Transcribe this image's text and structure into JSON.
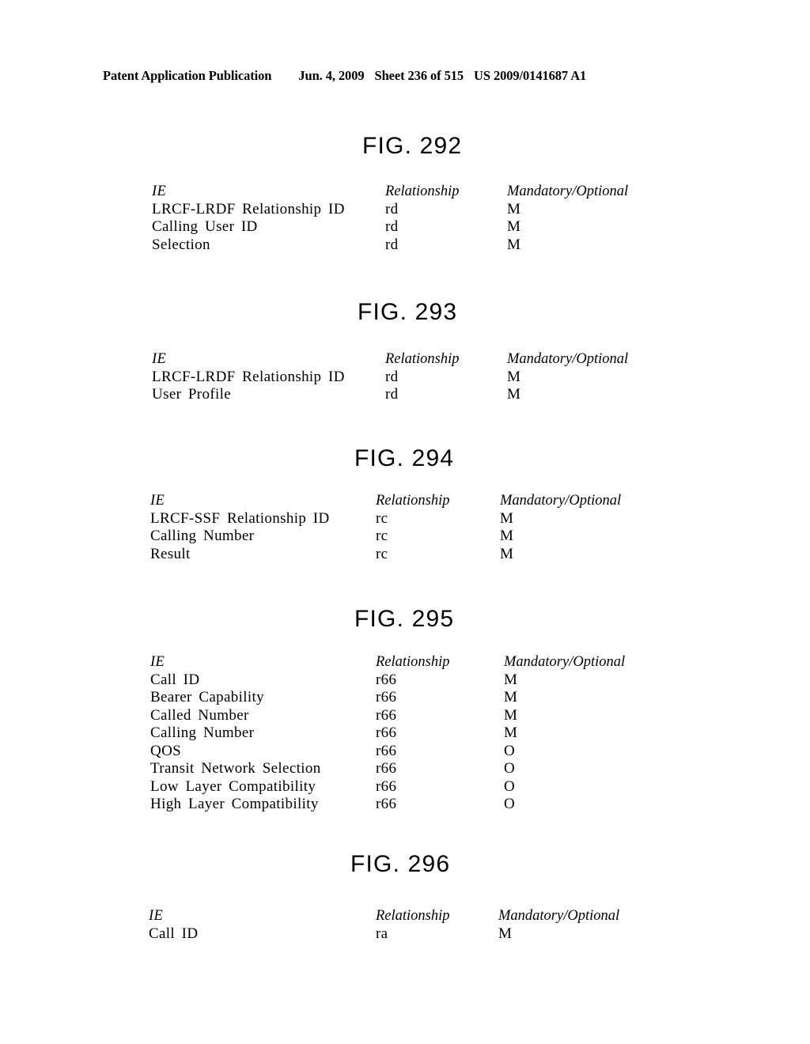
{
  "header": {
    "publication": "Patent Application Publication",
    "date": "Jun. 4, 2009",
    "sheet": "Sheet 236 of 515",
    "docnum": "US 2009/0141687 A1"
  },
  "columns": {
    "ie": "IE",
    "relationship": "Relationship",
    "mandatory_optional": "Mandatory/Optional"
  },
  "figures": [
    {
      "title": "FIG. 292",
      "rows": [
        {
          "ie": "LRCF-LRDF Relationship ID",
          "relationship": "rd",
          "mo": "M"
        },
        {
          "ie": "Calling  User ID",
          "relationship": "rd",
          "mo": "M"
        },
        {
          "ie": "Selection",
          "relationship": "rd",
          "mo": "M"
        }
      ]
    },
    {
      "title": "FIG. 293",
      "rows": [
        {
          "ie": "LRCF-LRDF Relationship ID",
          "relationship": "rd",
          "mo": "M"
        },
        {
          "ie": "User Profile",
          "relationship": "rd",
          "mo": "M"
        }
      ]
    },
    {
      "title": "FIG. 294",
      "rows": [
        {
          "ie": "LRCF-SSF Relationship ID",
          "relationship": "rc",
          "mo": "M"
        },
        {
          "ie": "Calling Number",
          "relationship": "rc",
          "mo": "M"
        },
        {
          "ie": "Result",
          "relationship": "rc",
          "mo": "M"
        }
      ]
    },
    {
      "title": "FIG. 295",
      "rows": [
        {
          "ie": "Call ID",
          "relationship": "r66",
          "mo": "M"
        },
        {
          "ie": "Bearer Capability",
          "relationship": "r66",
          "mo": "M"
        },
        {
          "ie": "Called Number",
          "relationship": "r66",
          "mo": "M"
        },
        {
          "ie": "Calling Number",
          "relationship": "r66",
          "mo": "M"
        },
        {
          "ie": "QOS",
          "relationship": "r66",
          "mo": "O"
        },
        {
          "ie": "Transit Network Selection",
          "relationship": "r66",
          "mo": "O"
        },
        {
          "ie": "Low Layer Compatibility",
          "relationship": "r66",
          "mo": "O"
        },
        {
          "ie": "High Layer Compatibility",
          "relationship": "r66",
          "mo": "O"
        }
      ]
    },
    {
      "title": "FIG. 296",
      "rows": [
        {
          "ie": "Call ID",
          "relationship": "ra",
          "mo": "M"
        }
      ]
    }
  ]
}
